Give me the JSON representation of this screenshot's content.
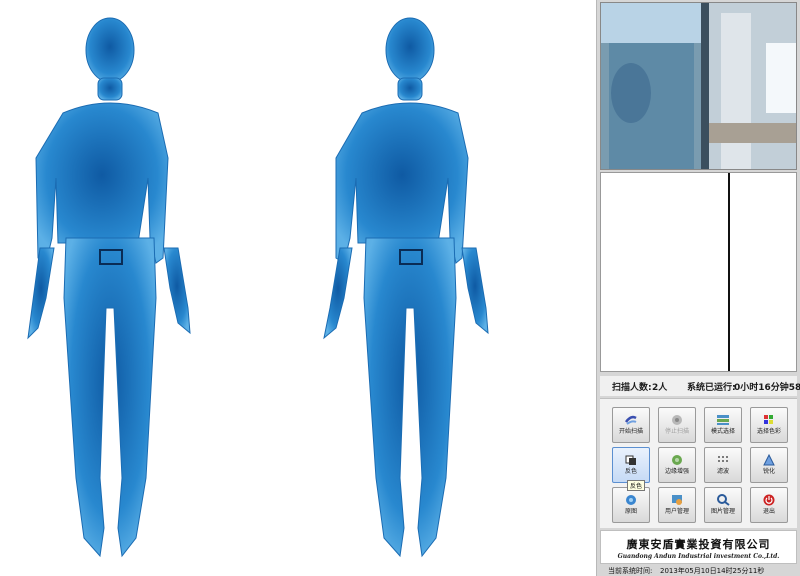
{
  "scans": [
    {
      "name": "scan-image-1"
    },
    {
      "name": "scan-image-2"
    }
  ],
  "stats": {
    "scan_count_label": "扫描人数:",
    "scan_count_value": "2人",
    "runtime_label": "系统已运行:",
    "runtime_value": "0小时16分钟58秒"
  },
  "buttons": [
    {
      "label": "开始扫描",
      "icon": "scan-start-icon"
    },
    {
      "label": "停止扫描",
      "icon": "scan-stop-icon",
      "disabled": true
    },
    {
      "label": "模式选择",
      "icon": "mode-icon"
    },
    {
      "label": "选择色彩",
      "icon": "palette-icon"
    },
    {
      "label": "反色",
      "icon": "invert-icon",
      "active": true
    },
    {
      "label": "边缘增强",
      "icon": "edge-icon"
    },
    {
      "label": "滤波",
      "icon": "filter-icon"
    },
    {
      "label": "锐化",
      "icon": "sharpen-icon"
    },
    {
      "label": "原图",
      "icon": "original-icon"
    },
    {
      "label": "用户管理",
      "icon": "user-icon"
    },
    {
      "label": "图片管理",
      "icon": "image-search-icon"
    },
    {
      "label": "退出",
      "icon": "power-icon"
    }
  ],
  "tooltip": "反色",
  "company": {
    "name_cn": "廣東安盾實業投資有限公司",
    "name_en": "Guandong Andun Industrial investment Co.,Ltd."
  },
  "status": {
    "time_label": "当前系统时间:",
    "time_value": "2013年05月10日14时25分11秒"
  },
  "colors": {
    "scan_blue": "#1f7ec4",
    "panel_bg": "#d6d6d6",
    "exit_red": "#cc2222"
  }
}
